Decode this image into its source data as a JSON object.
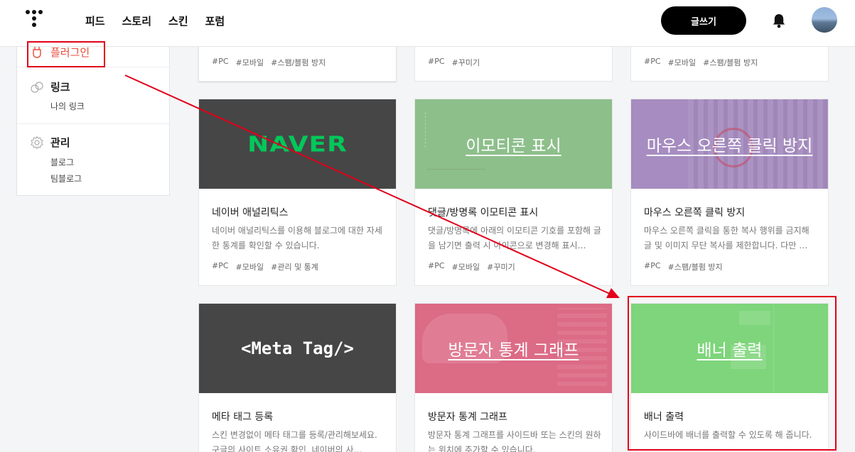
{
  "header": {
    "nav": [
      "피드",
      "스토리",
      "스킨",
      "포럼"
    ],
    "write_label": "글쓰기"
  },
  "sidebar": {
    "plugin_label": "플러그인",
    "link": {
      "title": "링크",
      "items": [
        "나의 링크"
      ]
    },
    "manage": {
      "title": "관리",
      "items": [
        "블로그",
        "팀블로그"
      ]
    }
  },
  "cards_top_tags": [
    [
      "#PC",
      "#모바일",
      "#스팸/블펌 방지"
    ],
    [
      "#PC",
      "#꾸미기"
    ],
    [
      "#PC",
      "#모바일",
      "#스팸/블펌 방지"
    ]
  ],
  "cards": [
    {
      "thumb_text": "NAVER",
      "title": "네이버 애널리틱스",
      "desc": "네이버 애널리틱스를 이용해 블로그에 대한 자세한 통계를 확인할 수 있습니다.",
      "tags": [
        "#PC",
        "#모바일",
        "#관리 및 통계"
      ]
    },
    {
      "thumb_text": "이모티콘 표시",
      "title": "댓글/방명록 이모티콘 표시",
      "desc": "댓글/방명록에 아래의 이모티콘 기호를 포함해 글을 남기면 출력 시 아이콘으로 변경해 표시…",
      "tags": [
        "#PC",
        "#모바일",
        "#꾸미기"
      ]
    },
    {
      "thumb_text": "마우스 오른쪽 클릭 방지",
      "title": "마우스 오른쪽 클릭 방지",
      "desc": "마우스 오른쪽 클릭을 통한 복사 행위를 금지해 글 및 이미지 무단 복사를 제한합니다. 다만 …",
      "tags": [
        "#PC",
        "#스팸/블펌 방지"
      ]
    },
    {
      "thumb_text": "<Meta Tag/>",
      "title": "메타 태그 등록",
      "desc": "스킨 변경없이 메타 태그를 등록/관리해보세요. 구글의 사이트 소유권 확인, 네이버의 사…"
    },
    {
      "thumb_text": "방문자 통계 그래프",
      "title": "방문자 통계 그래프",
      "desc": "방문자 통계 그래프를 사이드바 또는 스킨의 원하는 위치에 추가할 수 있습니다."
    },
    {
      "thumb_text": "배너 출력",
      "title": "배너 출력",
      "desc": "사이드바에 배너를 출력할 수 있도록 해 줍니다."
    }
  ],
  "colors": {
    "emoticon": "#8dbf8b",
    "mouse": "#a68cc0",
    "visitor": "#dc6b86",
    "banner": "#7ed57b",
    "highlight": "#e2001a"
  }
}
